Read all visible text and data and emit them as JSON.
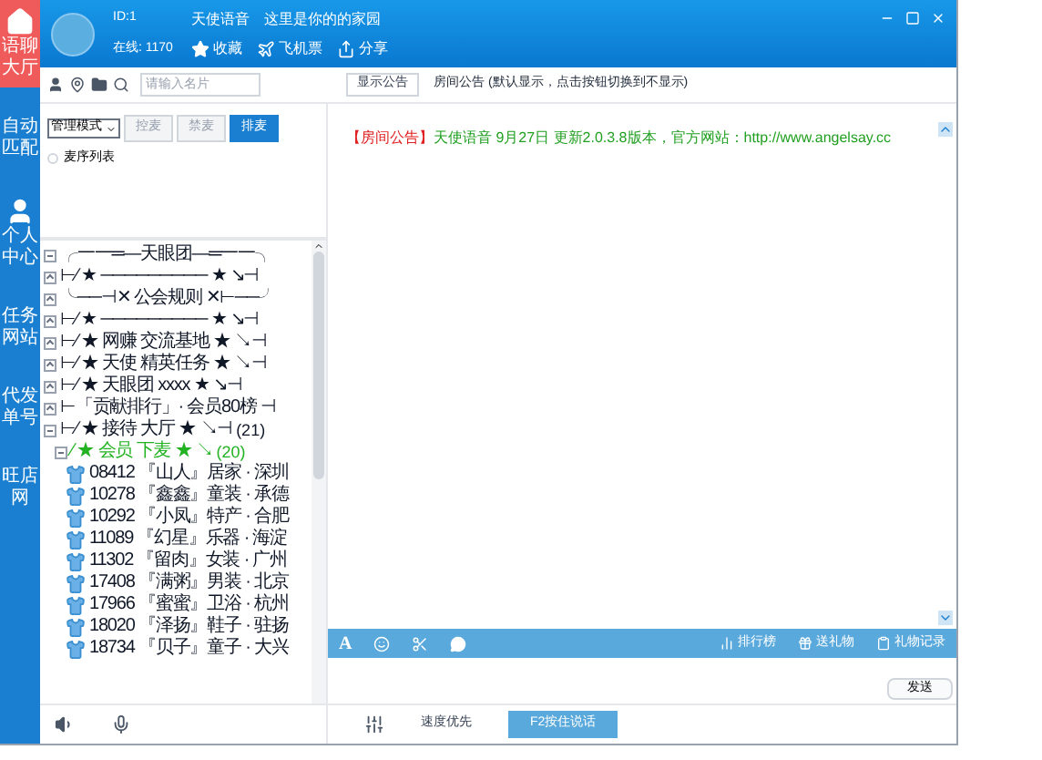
{
  "nav": [
    {
      "label": "语聊大厅",
      "selected": true
    },
    {
      "label": "自动匹配",
      "selected": false
    },
    {
      "label": "个人中心",
      "selected": false
    },
    {
      "label": "任务网站",
      "selected": false
    },
    {
      "label": "代发单号",
      "selected": false
    },
    {
      "label": "旺店网",
      "selected": false
    }
  ],
  "header": {
    "id": "ID:1",
    "online": "在线: 1170",
    "title": "天使语音",
    "slogan": "这里是你的的家园",
    "actions": [
      "收藏",
      "飞机票",
      "分享"
    ]
  },
  "search": {
    "placeholder": "请输入名片"
  },
  "notice_button": "显示公告",
  "notice_hint": "房间公告 (默认显示，点击按钮切换到不显示)",
  "mic_controls": {
    "mode": "管理模式",
    "buttons": [
      {
        "label": "控麦",
        "selected": false
      },
      {
        "label": "禁麦",
        "selected": false
      },
      {
        "label": "排麦",
        "selected": true
      }
    ]
  },
  "mic_queue": {
    "label": "麦序列表",
    "expanded": false
  },
  "tree": [
    {
      "label": "╭一一═—天眼团—═一一╮",
      "expanded": true,
      "kind": "group"
    },
    {
      "label": "⊢⁄ ★ ───────── ★ ↘⊣",
      "expanded": false,
      "kind": "group"
    },
    {
      "label": "╰──⊣✕  公会规则  ✕⊢──╯",
      "expanded": false,
      "kind": "group"
    },
    {
      "label": "⊢⁄ ★ ───────── ★ ↘⊣",
      "expanded": false,
      "kind": "group"
    },
    {
      "label": "⊢⁄ ★  网赚  交流基地 ★ ↘⊣",
      "expanded": false,
      "kind": "group"
    },
    {
      "label": "⊢⁄ ★  天使  精英任务 ★ ↘⊣",
      "expanded": false,
      "kind": "group"
    },
    {
      "label": "⊢⁄ ★ 天眼团  xxxx   ★ ↘⊣",
      "expanded": false,
      "kind": "group"
    },
    {
      "label": "⊢「贡献排行」·  会员80榜 ⊣",
      "expanded": false,
      "kind": "group"
    },
    {
      "label": "⊢⁄ ★  接待  大厅  ★ ↘⊣",
      "count": "(21)",
      "expanded": true,
      "kind": "group",
      "children": [
        {
          "label": "⁄ ★  会员  下麦  ★ ↘",
          "count": "(20)",
          "expanded": true,
          "kind": "group",
          "highlighted": true,
          "children": [
            {
              "label": "08412 『山人』居家 · 深圳",
              "kind": "user"
            },
            {
              "label": "10278 『鑫鑫』童装 · 承德",
              "kind": "user"
            },
            {
              "label": "10292 『小凤』特产 · 合肥",
              "kind": "user"
            },
            {
              "label": "11089 『幻星』乐器 · 海淀",
              "kind": "user"
            },
            {
              "label": "11302 『留肉』女装 · 广州",
              "kind": "user"
            },
            {
              "label": "17408 『满粥』男装 · 北京",
              "kind": "user"
            },
            {
              "label": "17966 『蜜蜜』卫浴 · 杭州",
              "kind": "user"
            },
            {
              "label": "18020 『泽扬』鞋子 · 驻扬",
              "kind": "user"
            },
            {
              "label": "18734 『贝子』童子 · 大兴",
              "kind": "user"
            }
          ]
        }
      ]
    }
  ],
  "announcement": {
    "tag": "【房间公告】",
    "text": "天使语音  9月27日  更新2.0.3.8版本，官方网站：http://www.angelsay.cc"
  },
  "font_button": "A",
  "chat_tools": [
    "排行榜",
    "送礼物",
    "礼物记录"
  ],
  "send_button": "发送",
  "bottom": {
    "quality": "速度优先",
    "talk_button": "F2按住说话"
  }
}
